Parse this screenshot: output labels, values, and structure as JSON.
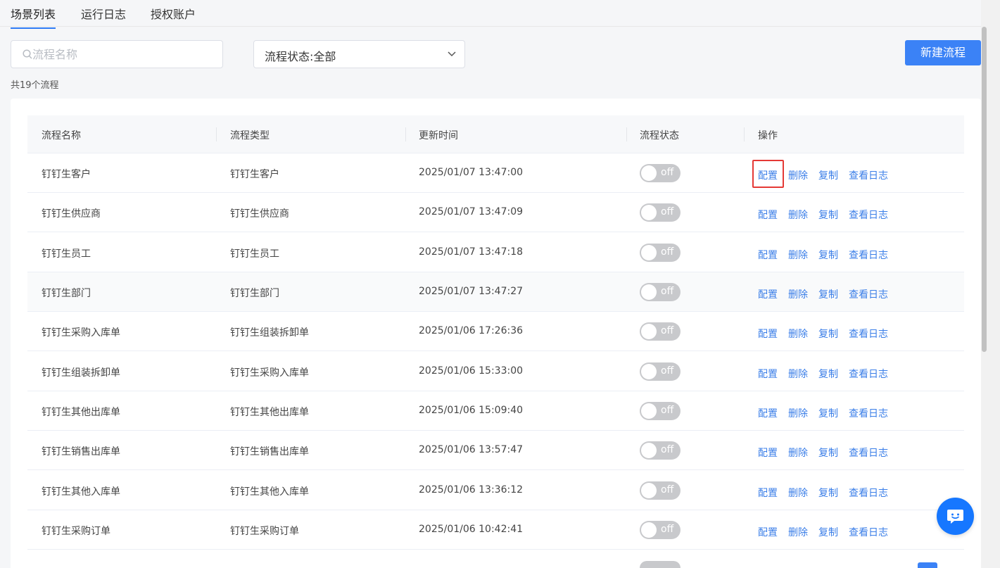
{
  "tabs": [
    {
      "label": "场景列表",
      "active": true
    },
    {
      "label": "运行日志",
      "active": false
    },
    {
      "label": "授权账户",
      "active": false
    }
  ],
  "search": {
    "placeholder": "流程名称",
    "value": ""
  },
  "status_filter": {
    "label": "流程状态:",
    "selected": "全部"
  },
  "new_button": "新建流程",
  "count_text": "共19个流程",
  "table": {
    "headers": [
      "流程名称",
      "流程类型",
      "更新时间",
      "流程状态",
      "操作"
    ],
    "actions": [
      "配置",
      "删除",
      "复制",
      "查看日志"
    ],
    "rows": [
      {
        "name": "钉钉生客户",
        "type": "钉钉生客户",
        "updated": "2025/01/07 13:47:00",
        "status": "off"
      },
      {
        "name": "钉钉生供应商",
        "type": "钉钉生供应商",
        "updated": "2025/01/07 13:47:09",
        "status": "off"
      },
      {
        "name": "钉钉生员工",
        "type": "钉钉生员工",
        "updated": "2025/01/07 13:47:18",
        "status": "off"
      },
      {
        "name": "钉钉生部门",
        "type": "钉钉生部门",
        "updated": "2025/01/07 13:47:27",
        "status": "off"
      },
      {
        "name": "钉钉生采购入库单",
        "type": "钉钉生组装拆卸单",
        "updated": "2025/01/06 17:26:36",
        "status": "off"
      },
      {
        "name": "钉钉生组装拆卸单",
        "type": "钉钉生采购入库单",
        "updated": "2025/01/06 15:33:00",
        "status": "off"
      },
      {
        "name": "钉钉生其他出库单",
        "type": "钉钉生其他出库单",
        "updated": "2025/01/06 15:09:40",
        "status": "off"
      },
      {
        "name": "钉钉生销售出库单",
        "type": "钉钉生销售出库单",
        "updated": "2025/01/06 13:57:47",
        "status": "off"
      },
      {
        "name": "钉钉生其他入库单",
        "type": "钉钉生其他入库单",
        "updated": "2025/01/06 13:36:12",
        "status": "off"
      },
      {
        "name": "钉钉生采购订单",
        "type": "钉钉生采购订单",
        "updated": "2025/01/06 10:42:41",
        "status": "off"
      }
    ]
  },
  "colors": {
    "accent": "#3b82f6",
    "link": "#3a7ee8",
    "highlight": "#e53935",
    "switch_off": "#c8c9cc"
  }
}
